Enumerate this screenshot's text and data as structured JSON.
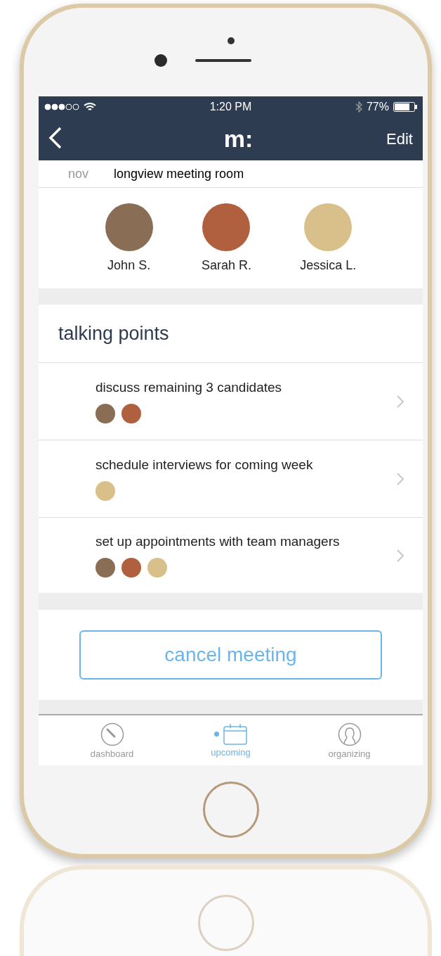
{
  "status_bar": {
    "time": "1:20 PM",
    "battery": "77%"
  },
  "nav_bar": {
    "logo": "m:",
    "action": "Edit"
  },
  "meeting": {
    "month": "nov",
    "location": "longview meeting room"
  },
  "participants": [
    {
      "name": "John S.",
      "color": "#8a6d55"
    },
    {
      "name": "Sarah R.",
      "color": "#b0603f"
    },
    {
      "name": "Jessica L.",
      "color": "#d9c08a"
    }
  ],
  "talking_points": {
    "title": "talking points",
    "items": [
      {
        "text": "discuss remaining 3 candidates",
        "avatars": [
          {
            "color": "#8a6d55"
          },
          {
            "color": "#b0603f"
          }
        ]
      },
      {
        "text": "schedule interviews for coming week",
        "avatars": [
          {
            "color": "#d9c08a"
          }
        ]
      },
      {
        "text": "set up appointments with team managers",
        "avatars": [
          {
            "color": "#8a6d55"
          },
          {
            "color": "#b0603f"
          },
          {
            "color": "#d9c08a"
          }
        ]
      }
    ]
  },
  "cancel_button": "cancel meeting",
  "tabs": [
    {
      "label": "dashboard",
      "kind": "gauge",
      "selected": false
    },
    {
      "label": "upcoming",
      "kind": "calendar",
      "selected": true
    },
    {
      "label": "organizing",
      "kind": "person",
      "selected": false
    }
  ]
}
